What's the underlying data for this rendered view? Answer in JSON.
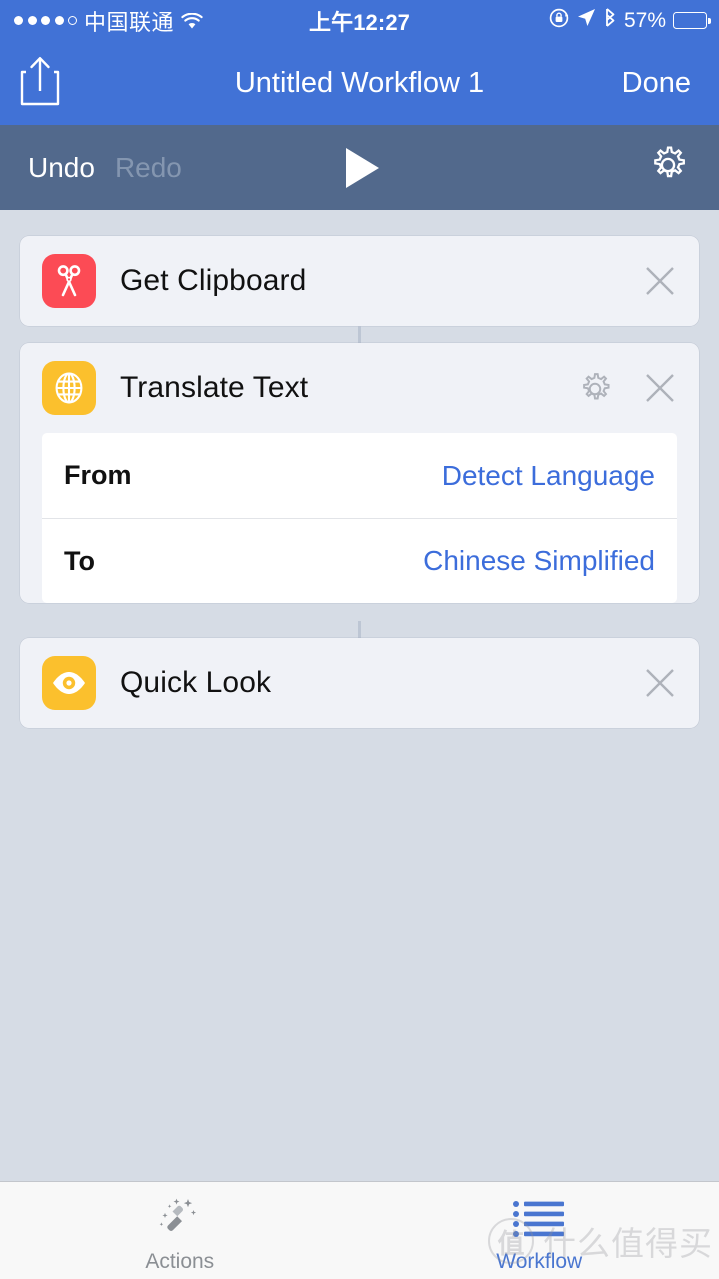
{
  "statusbar": {
    "signal_dots_filled": 4,
    "signal_dots_total": 5,
    "carrier": "中国联通",
    "wifi_icon": "wifi-icon",
    "time": "上午12:27",
    "rotation_lock_icon": "rotation-lock-icon",
    "location_icon": "location-arrow-icon",
    "bluetooth_icon": "bluetooth-icon",
    "battery_percent": "57%",
    "battery_level": 57
  },
  "navbar": {
    "share_icon": "share-icon",
    "title": "Untitled Workflow 1",
    "done_label": "Done",
    "bg_color": "#4172d6"
  },
  "toolbar": {
    "undo_label": "Undo",
    "redo_label": "Redo",
    "redo_disabled": true,
    "play_icon": "play-icon",
    "settings_icon": "gear-icon",
    "bg_color": "#52698c"
  },
  "canvas": {
    "bg_color": "#d6dce5",
    "actions": [
      {
        "title": "Get Clipboard",
        "icon": "scissors-icon",
        "icon_color": "#fc4b55",
        "has_settings": false,
        "close_icon": "close-icon",
        "params": []
      },
      {
        "title": "Translate Text",
        "icon": "globe-icon",
        "icon_color": "#fbc02d",
        "has_settings": true,
        "settings_icon": "gear-icon",
        "close_icon": "close-icon",
        "params": [
          {
            "label": "From",
            "value": "Detect Language",
            "value_color": "#3c6ddb"
          },
          {
            "label": "To",
            "value": "Chinese Simplified",
            "value_color": "#3c6ddb"
          }
        ]
      },
      {
        "title": "Quick Look",
        "icon": "eye-icon",
        "icon_color": "#fbc02d",
        "has_settings": false,
        "close_icon": "close-icon",
        "params": []
      }
    ]
  },
  "tabbar": {
    "tabs": [
      {
        "label": "Actions",
        "icon": "magic-wand-icon",
        "active": false,
        "color": "#8b8f94"
      },
      {
        "label": "Workflow",
        "icon": "bulleted-list-icon",
        "active": true,
        "color": "#4a76d0"
      }
    ]
  },
  "watermark": {
    "logo_text": "值",
    "text": "什么值得买"
  }
}
